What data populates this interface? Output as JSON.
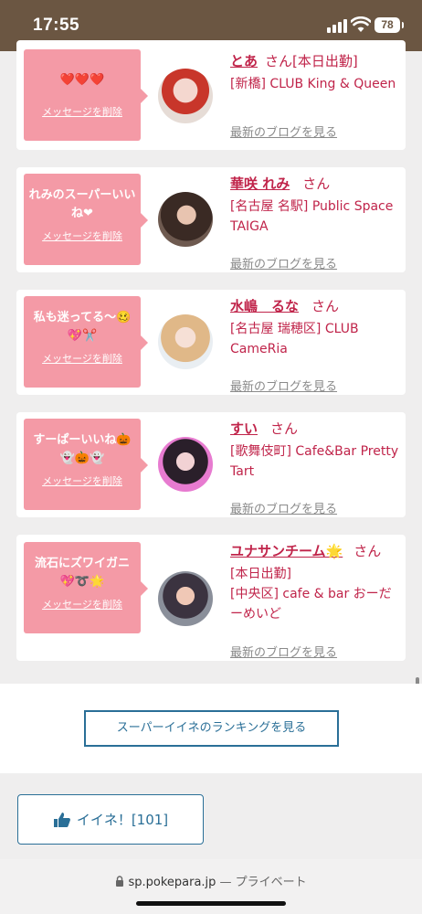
{
  "status_bar": {
    "time": "17:55",
    "battery": "78"
  },
  "cards": [
    {
      "message": "❤️❤️❤️",
      "delete_label": "メッセージを削除",
      "name": "とあ",
      "san": "さん",
      "badge": "[本日出勤]",
      "venue": "[新橋] CLUB King & Queen",
      "blog_label": "最新のブログを見る"
    },
    {
      "message": "れみのスーパーいいね❤︎",
      "delete_label": "メッセージを削除",
      "name": "華咲 れみ",
      "san": "さん",
      "badge": "",
      "venue": "[名古屋 名駅] Public Space TAIGA",
      "blog_label": "最新のブログを見る"
    },
    {
      "message": "私も迷ってる〜🥴💖✂️",
      "delete_label": "メッセージを削除",
      "name": "水嶋　るな",
      "san": "さん",
      "badge": "",
      "venue": "[名古屋 瑞穂区] CLUB CameRia",
      "blog_label": "最新のブログを見る"
    },
    {
      "message": "すーぱーいいね🎃👻🎃👻",
      "delete_label": "メッセージを削除",
      "name": "すい",
      "san": "さん",
      "badge": "",
      "venue": "[歌舞伎町] Cafe&Bar Pretty Tart",
      "blog_label": "最新のブログを見る"
    },
    {
      "message": "流石にズワイガニ💖➰🌟",
      "delete_label": "メッセージを削除",
      "name": "ユナサンチーム🌟",
      "san": "さん",
      "badge": "[本日出勤]",
      "venue": "[中央区] cafe & bar おーだーめいど",
      "blog_label": "最新のブログを見る"
    }
  ],
  "ranking_button": "スーパーイイネのランキングを見る",
  "like_button": "イイネ！[101]",
  "url_bar": {
    "domain": "sp.pokepara.jp",
    "privacy": "— プライベート"
  },
  "colors": {
    "accent": "#c0244a",
    "bubble": "#f49aa6",
    "link_blue": "#2a6f97",
    "status_bar": "#6b5642"
  }
}
